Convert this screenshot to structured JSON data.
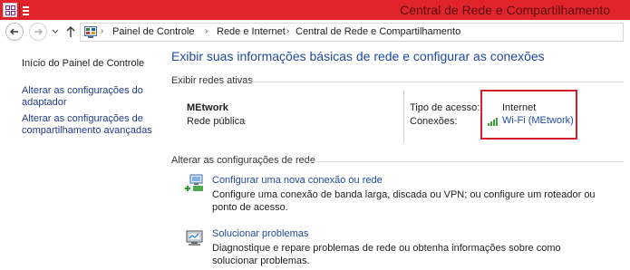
{
  "window": {
    "title": "Central de Rede e Compartilhamento",
    "titlebar_color": "#e1242b"
  },
  "address": {
    "breadcrumbs": [
      "Painel de Controle",
      "Rede e Internet",
      "Central de Rede e Compartilhamento"
    ],
    "separator": "›",
    "icons": {
      "back": "back-arrow-icon",
      "forward": "forward-arrow-icon",
      "recent": "chevron-down-icon",
      "up": "up-arrow-icon",
      "location": "control-panel-icon"
    }
  },
  "sidebar": {
    "items": [
      {
        "label": "Início do Painel de Controle"
      },
      {
        "label": "Alterar as configurações do adaptador"
      },
      {
        "label": "Alterar as configurações de compartilhamento avançadas"
      }
    ]
  },
  "main": {
    "title": "Exibir suas informações básicas de rede e configurar as conexões",
    "active_section_label": "Exibir redes ativas",
    "network": {
      "name": "MEtwork",
      "category": "Rede pública",
      "access_label": "Tipo de acesso:",
      "access_value": "Internet",
      "connections_label": "Conexões:",
      "connection_name": "Wi-Fi (MEtwork)",
      "connection_icon": "wifi-signal-icon"
    },
    "change_section_label": "Alterar as configurações de rede",
    "tasks": [
      {
        "icon": "new-connection-icon",
        "title": "Configurar uma nova conexão ou rede",
        "description": "Configure uma conexão de banda larga, discada ou VPN; ou configure um roteador ou ponto de acesso."
      },
      {
        "icon": "troubleshoot-icon",
        "title": "Solucionar problemas",
        "description": "Diagnostique e repare problemas de rede ou obtenha informações sobre como solucionar problemas."
      }
    ]
  },
  "colors": {
    "link": "#1f4aa0",
    "highlight_border": "#d0202e"
  }
}
